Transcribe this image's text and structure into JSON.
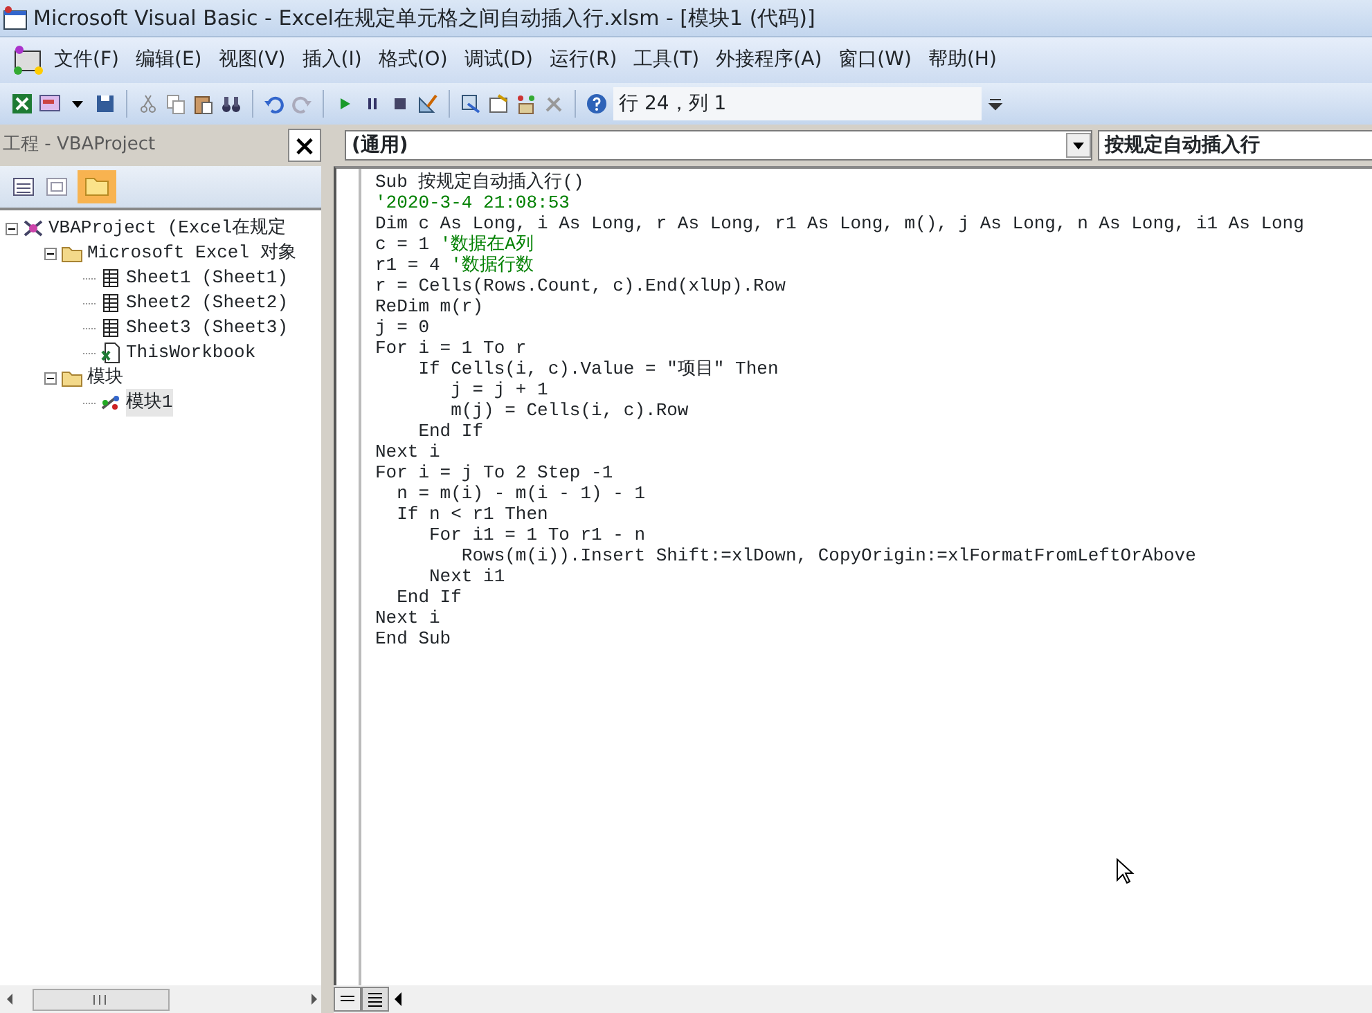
{
  "window": {
    "title": "Microsoft Visual Basic - Excel在规定单元格之间自动插入行.xlsm - [模块1 (代码)]"
  },
  "menu": [
    "文件(F)",
    "编辑(E)",
    "视图(V)",
    "插入(I)",
    "格式(O)",
    "调试(D)",
    "运行(R)",
    "工具(T)",
    "外接程序(A)",
    "窗口(W)",
    "帮助(H)"
  ],
  "toolbar": {
    "position": "行 24，列 1"
  },
  "project_pane": {
    "title": "工程 - VBAProject",
    "close": "×",
    "tree": [
      {
        "kind": "project",
        "label": "VBAProject (Excel在规定",
        "expanded": true,
        "selected": false,
        "children": [
          {
            "kind": "folder",
            "label": "Microsoft Excel 对象",
            "expanded": true,
            "selected": false,
            "children": [
              {
                "kind": "sheet",
                "label": "Sheet1 (Sheet1)",
                "selected": false
              },
              {
                "kind": "sheet",
                "label": "Sheet2 (Sheet2)",
                "selected": false
              },
              {
                "kind": "sheet",
                "label": "Sheet3 (Sheet3)",
                "selected": false
              },
              {
                "kind": "workbook",
                "label": "ThisWorkbook",
                "selected": false
              }
            ]
          },
          {
            "kind": "folder",
            "label": "模块",
            "expanded": true,
            "selected": false,
            "children": [
              {
                "kind": "module",
                "label": "模块1",
                "selected": true
              }
            ]
          }
        ]
      }
    ]
  },
  "code_window": {
    "object_dropdown": "(通用)",
    "procedure_dropdown": "按规定自动插入行",
    "lines": [
      {
        "code": "Sub 按规定自动插入行()"
      },
      {
        "comment": "'2020-3-4 21:08:53"
      },
      {
        "code": "Dim c As Long, i As Long, r As Long, r1 As Long, m(), j As Long, n As Long, i1 As Long"
      },
      {
        "code": "c = 1 ",
        "comment": "'数据在A列"
      },
      {
        "code": "r1 = 4 ",
        "comment": "'数据行数"
      },
      {
        "code": "r = Cells(Rows.Count, c).End(xlUp).Row"
      },
      {
        "code": "ReDim m(r)"
      },
      {
        "code": "j = 0"
      },
      {
        "code": "For i = 1 To r"
      },
      {
        "code": "    If Cells(i, c).Value = \"项目\" Then"
      },
      {
        "code": "       j = j + 1"
      },
      {
        "code": "       m(j) = Cells(i, c).Row"
      },
      {
        "code": "    End If"
      },
      {
        "code": "Next i"
      },
      {
        "code": "For i = j To 2 Step -1"
      },
      {
        "code": "  n = m(i) - m(i - 1) - 1"
      },
      {
        "code": "  If n < r1 Then"
      },
      {
        "code": "     For i1 = 1 To r1 - n"
      },
      {
        "code": "        Rows(m(i)).Insert Shift:=xlDown, CopyOrigin:=xlFormatFromLeftOrAbove"
      },
      {
        "code": "     Next i1"
      },
      {
        "code": "  End If"
      },
      {
        "code": "Next i"
      },
      {
        "code": "End Sub"
      }
    ]
  }
}
